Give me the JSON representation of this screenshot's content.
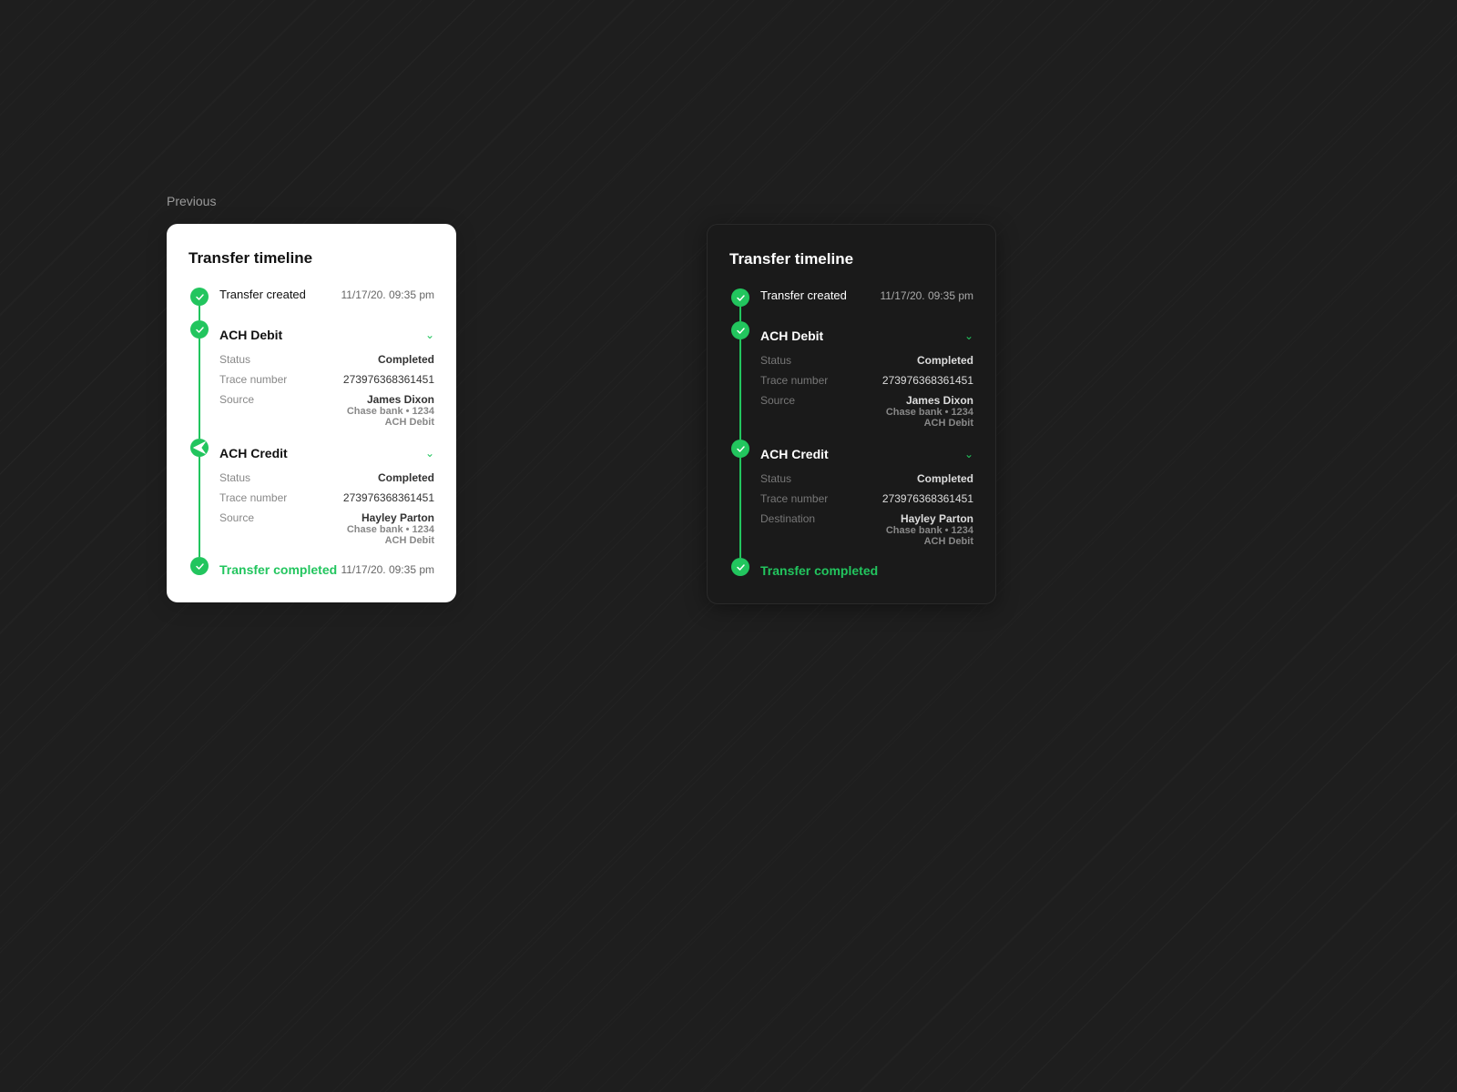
{
  "previous_label": "Previous",
  "card_light": {
    "title": "Transfer timeline",
    "created": {
      "label": "Transfer created",
      "date": "11/17/20. 09:35 pm"
    },
    "ach_debit": {
      "title": "ACH Debit",
      "status_key": "Status",
      "status_value": "Completed",
      "trace_key": "Trace number",
      "trace_value": "273976368361451",
      "source_key": "Source",
      "source_name": "James Dixon",
      "source_bank": "Chase bank • 1234",
      "source_type": "ACH Debit"
    },
    "ach_credit": {
      "title": "ACH Credit",
      "status_key": "Status",
      "status_value": "Completed",
      "trace_key": "Trace number",
      "trace_value": "273976368361451",
      "source_key": "Source",
      "source_name": "Hayley Parton",
      "source_bank": "Chase bank • 1234",
      "source_type": "ACH Debit"
    },
    "completed": {
      "label": "Transfer completed",
      "date": "11/17/20. 09:35 pm"
    }
  },
  "card_dark": {
    "title": "Transfer timeline",
    "created": {
      "label": "Transfer created",
      "date": "11/17/20. 09:35 pm"
    },
    "ach_debit": {
      "title": "ACH Debit",
      "status_key": "Status",
      "status_value": "Completed",
      "trace_key": "Trace number",
      "trace_value": "273976368361451",
      "source_key": "Source",
      "source_name": "James Dixon",
      "source_bank": "Chase bank • 1234",
      "source_type": "ACH Debit"
    },
    "ach_credit": {
      "title": "ACH Credit",
      "status_key": "Status",
      "status_value": "Completed",
      "trace_key": "Trace number",
      "trace_value": "273976368361451",
      "dest_key": "Destination",
      "dest_name": "Hayley Parton",
      "dest_bank": "Chase bank • 1234",
      "dest_type": "ACH Debit"
    },
    "completed": {
      "label": "Transfer completed"
    }
  },
  "icons": {
    "check": "✓",
    "send": "➤",
    "chevron_down": "∨"
  },
  "colors": {
    "green": "#22c55e",
    "light_bg": "#ffffff",
    "dark_bg": "#1a1a1a"
  }
}
